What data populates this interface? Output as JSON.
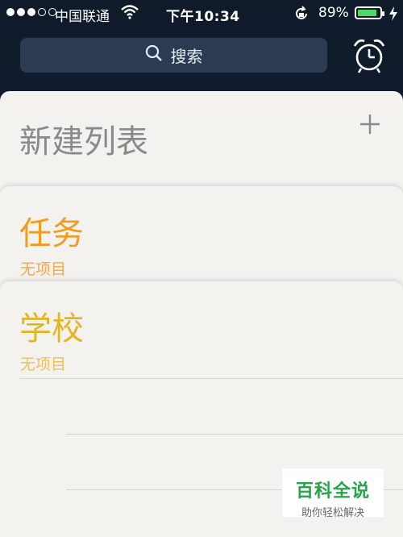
{
  "status": {
    "carrier": "中国联通",
    "time": "下午10:34",
    "battery_pct": "89%",
    "battery_level": 0.89
  },
  "search": {
    "label": "搜索"
  },
  "lists": [
    {
      "title": "新建列表",
      "color": "#8a8a8a"
    },
    {
      "title": "任务",
      "subtitle": "无项目",
      "color": "#f29b1d"
    },
    {
      "title": "学校",
      "subtitle": "无项目",
      "color": "#e2b523"
    }
  ],
  "watermark": {
    "title": "百科全说",
    "subtitle": "助你轻松解决"
  },
  "colors": {
    "accent": "#4cd964",
    "background": "#0f1a2b"
  }
}
